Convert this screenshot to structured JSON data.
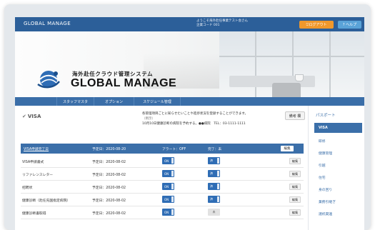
{
  "header": {
    "brand": "GLOBAL MANAGE",
    "welcome_line1": "ようこそ海外赴任事業テスト会さん",
    "welcome_line2": "企業コード 001",
    "logout_label": "⎋ログアウト",
    "help_label": "? ヘルプ"
  },
  "hero": {
    "system_name": "海外赴任クラウド管理システム",
    "logo_text": "GLOBAL MANAGE"
  },
  "nav": {
    "items": [
      "スタッフマスタ",
      "オプション",
      "スケジュール管理"
    ]
  },
  "section": {
    "title": "VISA",
    "notice_line1": "各管理項目ごとに知らせたいことや進捗状況を登録することができます。",
    "notice_line2": "（例示）",
    "notice_line3": "10月10日健康診断の病院を予約する。●●病院　TEL：03-1111-1111",
    "remark_button": "備考 欄"
  },
  "table": {
    "header_title": "VISA申請完了日",
    "header_due": "予定日：2020-08-20",
    "header_alert": "アラート：OFF",
    "header_done": "完了：未",
    "header_edit": "編集",
    "rows": [
      {
        "name": "VISA申請書式",
        "due": "予定日：2020-08-02",
        "alert": "ON",
        "done": "済",
        "edit": "編集"
      },
      {
        "name": "リファレンスレター",
        "due": "予定日：2020-08-02",
        "alert": "ON",
        "done": "済",
        "edit": "編集"
      },
      {
        "name": "招聘状",
        "due": "予定日：2020-08-02",
        "alert": "ON",
        "done": "済",
        "edit": "編集"
      },
      {
        "name": "健康診断（赴任先国指定病院）",
        "due": "予定日：2020-08-02",
        "alert": "ON",
        "done": "済",
        "edit": "編集"
      },
      {
        "name": "健康診断書取得",
        "due": "予定日：2020-08-02",
        "alert": "ON",
        "done": "未",
        "edit": "編集"
      }
    ]
  },
  "sidebar": {
    "items": [
      "パスポート",
      "VISA",
      "研修",
      "健康管理",
      "引越",
      "住宅",
      "身の回り",
      "業務引継ぎ",
      "諸机関連"
    ],
    "active_index": 1
  },
  "colors": {
    "primary": "#3b6fa9",
    "topbar": "#2c5f99",
    "logout": "#f0982c",
    "help": "#5aa3d8"
  }
}
